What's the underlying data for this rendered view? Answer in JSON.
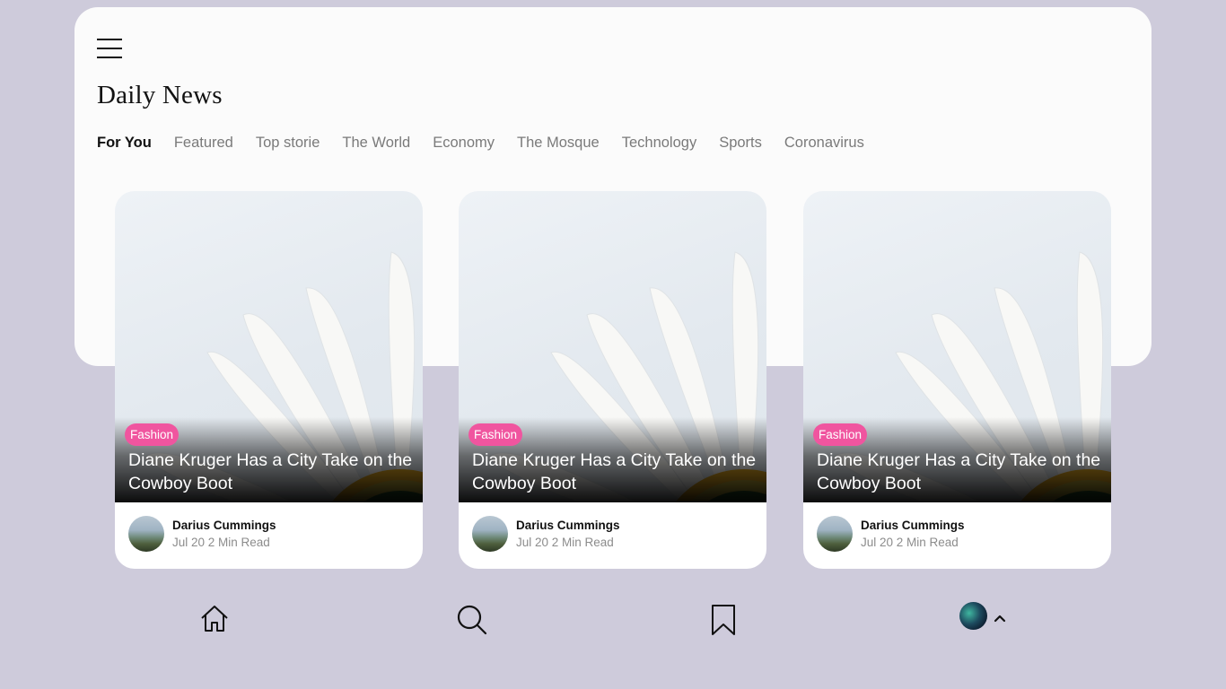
{
  "header": {
    "title": "Daily News",
    "menu_icon": "hamburger-menu-icon"
  },
  "tabs": [
    {
      "label": "For You",
      "active": true
    },
    {
      "label": "Featured",
      "active": false
    },
    {
      "label": "Top storie",
      "active": false
    },
    {
      "label": "The World",
      "active": false
    },
    {
      "label": "Economy",
      "active": false
    },
    {
      "label": "The Mosque",
      "active": false
    },
    {
      "label": "Technology",
      "active": false
    },
    {
      "label": "Sports",
      "active": false
    },
    {
      "label": "Coronavirus",
      "active": false
    }
  ],
  "cards": [
    {
      "category": "Fashion",
      "headline": "Diane Kruger Has a City Take on the Cowboy Boot",
      "author": "Darius Cummings",
      "meta": "Jul 20 2 Min Read"
    },
    {
      "category": "Fashion",
      "headline": "Diane Kruger Has a City Take on the Cowboy Boot",
      "author": "Darius Cummings",
      "meta": "Jul 20 2 Min Read"
    },
    {
      "category": "Fashion",
      "headline": "Diane Kruger Has a City Take on the Cowboy Boot",
      "author": "Darius Cummings",
      "meta": "Jul 20 2 Min Read"
    }
  ],
  "bottom_nav": {
    "items": [
      "home-icon",
      "search-icon",
      "bookmark-icon",
      "profile-avatar"
    ]
  },
  "colors": {
    "background": "#cecbdb",
    "panel": "#fbfbfb",
    "badge": "#f0559f"
  }
}
